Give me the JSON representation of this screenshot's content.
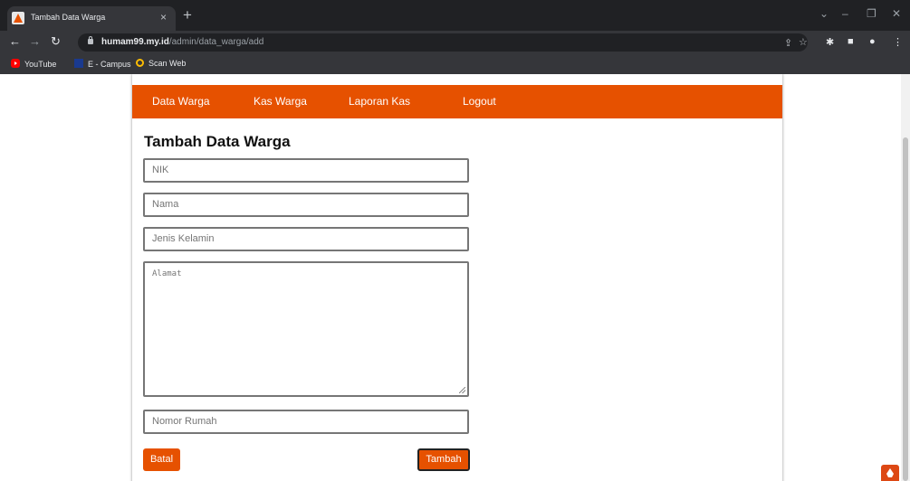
{
  "browser": {
    "tab_title": "Tambah Data Warga",
    "tab_close": "×",
    "new_tab": "+",
    "url_host": "humam99.my.id",
    "url_path": "/admin/data_warga/add",
    "bookmarks": [
      {
        "label": "YouTube",
        "icon": "youtube-icon"
      },
      {
        "label": "E - Campus",
        "icon": "ecampus-icon"
      },
      {
        "label": "Scan Web",
        "icon": "search-icon"
      }
    ]
  },
  "nav": {
    "items": [
      "Data Warga",
      "Kas Warga",
      "Laporan Kas",
      "Logout"
    ],
    "color": "#e65100"
  },
  "form": {
    "title": "Tambah Data Warga",
    "nik_placeholder": "NIK",
    "nama_placeholder": "Nama",
    "jk_placeholder": "Jenis Kelamin",
    "alamat_placeholder": "Alamat",
    "nomor_rumah_placeholder": "Nomor Rumah",
    "cancel_label": "Batal",
    "submit_label": "Tambah"
  }
}
